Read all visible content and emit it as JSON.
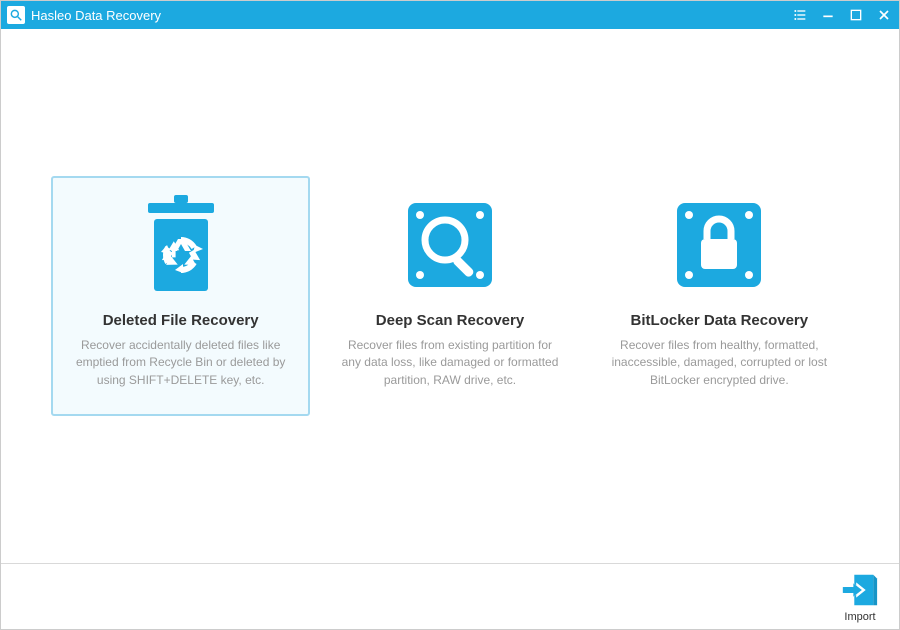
{
  "titlebar": {
    "title": "Hasleo Data Recovery"
  },
  "cards": [
    {
      "title": "Deleted File Recovery",
      "desc": "Recover accidentally deleted files like emptied from Recycle Bin or deleted by using SHIFT+DELETE key, etc.",
      "selected": true
    },
    {
      "title": "Deep Scan Recovery",
      "desc": "Recover files from existing partition for any data loss, like damaged or formatted partition, RAW drive, etc.",
      "selected": false
    },
    {
      "title": "BitLocker Data Recovery",
      "desc": "Recover files from healthy, formatted, inaccessible, damaged, corrupted or lost BitLocker encrypted drive.",
      "selected": false
    }
  ],
  "footer": {
    "import_label": "Import"
  },
  "colors": {
    "accent": "#1ca9e0"
  }
}
